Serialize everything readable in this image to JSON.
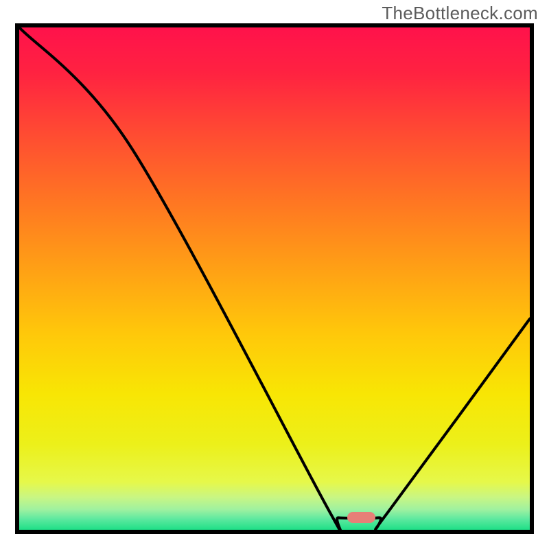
{
  "watermark": "TheBottleneck.com",
  "frame": {
    "inner_width": 744,
    "inner_height": 732
  },
  "gradient": {
    "stops": [
      {
        "offset": 0.0,
        "color": "#ff124b"
      },
      {
        "offset": 0.09,
        "color": "#ff2241"
      },
      {
        "offset": 0.22,
        "color": "#ff4e31"
      },
      {
        "offset": 0.35,
        "color": "#ff7722"
      },
      {
        "offset": 0.48,
        "color": "#ffa015"
      },
      {
        "offset": 0.61,
        "color": "#ffc80a"
      },
      {
        "offset": 0.73,
        "color": "#f8e604"
      },
      {
        "offset": 0.83,
        "color": "#ecf01a"
      },
      {
        "offset": 0.905,
        "color": "#e6f84a"
      },
      {
        "offset": 0.935,
        "color": "#c9f683"
      },
      {
        "offset": 0.96,
        "color": "#9ef1a0"
      },
      {
        "offset": 0.978,
        "color": "#5fe9a0"
      },
      {
        "offset": 1.0,
        "color": "#1fdf87"
      }
    ]
  },
  "chart_data": {
    "type": "line",
    "title": "",
    "xlabel": "",
    "ylabel": "",
    "xlim": [
      0,
      100
    ],
    "ylim": [
      0,
      100
    ],
    "series": [
      {
        "name": "bottleneck-curve",
        "points": [
          {
            "x": 0.0,
            "y": 100.0
          },
          {
            "x": 22.0,
            "y": 76.0
          },
          {
            "x": 61.0,
            "y": 3.2
          },
          {
            "x": 62.5,
            "y": 2.4
          },
          {
            "x": 70.5,
            "y": 2.4
          },
          {
            "x": 72.0,
            "y": 3.2
          },
          {
            "x": 100.0,
            "y": 42.0
          }
        ]
      }
    ],
    "marker": {
      "name": "optimal-point",
      "x_center": 67.0,
      "y_center": 2.5,
      "width_pct": 5.5,
      "height_pct": 2.2,
      "color": "#e77f77"
    }
  }
}
